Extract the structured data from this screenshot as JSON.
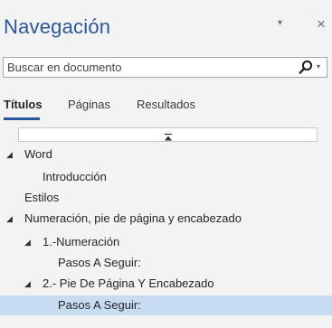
{
  "pane": {
    "title": "Navegación",
    "menu_glyph": "▾",
    "close_glyph": "×"
  },
  "search": {
    "placeholder": "Buscar en documento",
    "icon": "search-icon",
    "dropdown_glyph": "▾"
  },
  "tabs": [
    {
      "label": "Títulos",
      "active": true
    },
    {
      "label": "Páginas",
      "active": false
    },
    {
      "label": "Resultados",
      "active": false
    }
  ],
  "collapse_icon": "collapse-all-icon",
  "tree": [
    {
      "label": "Word",
      "expanded": true,
      "level": 0,
      "selected": false
    },
    {
      "label": "Introducción",
      "expanded": null,
      "level": 1,
      "selected": false
    },
    {
      "label": "Estilos",
      "expanded": null,
      "level": 0,
      "selected": false
    },
    {
      "label": "Numeración, pie de página y encabezado",
      "expanded": true,
      "level": 0,
      "selected": false
    },
    {
      "label": "1.-Numeración",
      "expanded": true,
      "level": 1,
      "selected": false
    },
    {
      "label": "Pasos A Seguir:",
      "expanded": null,
      "level": 2,
      "selected": false
    },
    {
      "label": "2.- Pie De Página Y Encabezado",
      "expanded": true,
      "level": 1,
      "selected": false
    },
    {
      "label": "Pasos A Seguir:",
      "expanded": null,
      "level": 2,
      "selected": true
    }
  ],
  "colors": {
    "accent": "#2b579a",
    "selection": "#c7dcf3",
    "background": "#f3f3f3"
  }
}
